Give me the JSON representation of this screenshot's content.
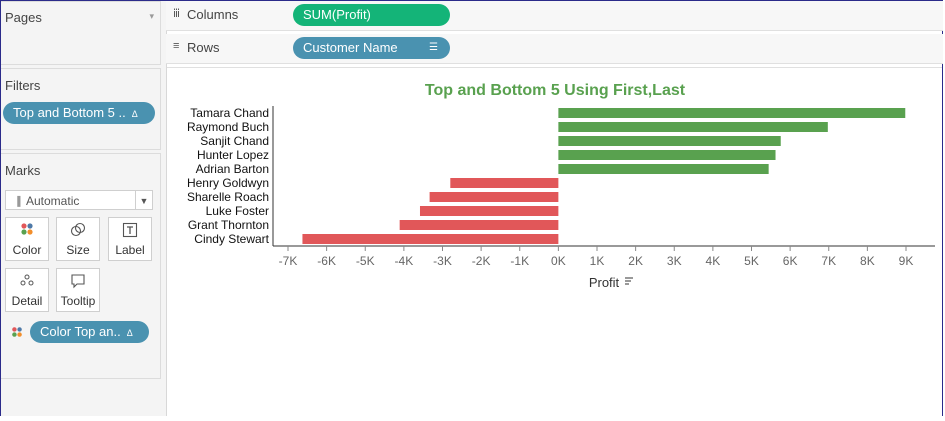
{
  "panels": {
    "pages": {
      "title": "Pages",
      "collapse_icon": "chevron-down-icon"
    },
    "filters": {
      "title": "Filters",
      "pill": {
        "label": "Top and Bottom 5 ..",
        "badge": "Δ"
      }
    },
    "marks": {
      "title": "Marks",
      "type_dropdown": {
        "value": "Automatic",
        "icon": "bar-chart-icon"
      },
      "buttons": [
        {
          "label": "Color",
          "icon": "color-dots-icon"
        },
        {
          "label": "Size",
          "icon": "size-circles-icon"
        },
        {
          "label": "Label",
          "icon": "label-t-icon"
        },
        {
          "label": "Detail",
          "icon": "detail-dots-icon"
        },
        {
          "label": "Tooltip",
          "icon": "tooltip-bubble-icon"
        }
      ],
      "color_pill": {
        "label": "Color Top an..",
        "badge": "Δ"
      }
    }
  },
  "shelves": {
    "columns": {
      "label": "Columns",
      "pill": "SUM(Profit)",
      "icon": "columns-icon"
    },
    "rows": {
      "label": "Rows",
      "pill": "Customer Name",
      "icon": "rows-icon",
      "sort_icon": "sort-icon"
    }
  },
  "colors": {
    "positive": "#59a14f",
    "negative": "#e15759",
    "title": "#59a14f",
    "pill_blue": "#4a92b0",
    "pill_green": "#14b478"
  },
  "chart_data": {
    "type": "bar",
    "orientation": "horizontal",
    "title": "Top and Bottom 5 Using First,Last",
    "xlabel": "Profit",
    "ylabel": "",
    "xlim": [
      -7000,
      9000
    ],
    "x_ticks": [
      -7000,
      -6000,
      -5000,
      -4000,
      -3000,
      -2000,
      -1000,
      0,
      1000,
      2000,
      3000,
      4000,
      5000,
      6000,
      7000,
      8000,
      9000
    ],
    "x_tick_labels": [
      "-7K",
      "-6K",
      "-5K",
      "-4K",
      "-3K",
      "-2K",
      "-1K",
      "0K",
      "1K",
      "2K",
      "3K",
      "4K",
      "5K",
      "6K",
      "7K",
      "8K",
      "9K"
    ],
    "categories": [
      "Tamara Chand",
      "Raymond Buch",
      "Sanjit Chand",
      "Hunter Lopez",
      "Adrian Barton",
      "Henry Goldwyn",
      "Sharelle Roach",
      "Luke Foster",
      "Grant Thornton",
      "Cindy Stewart"
    ],
    "values": [
      8981,
      6976,
      5757,
      5622,
      5444,
      -2798,
      -3334,
      -3583,
      -4109,
      -6626
    ],
    "grid": false,
    "legend": "none"
  }
}
